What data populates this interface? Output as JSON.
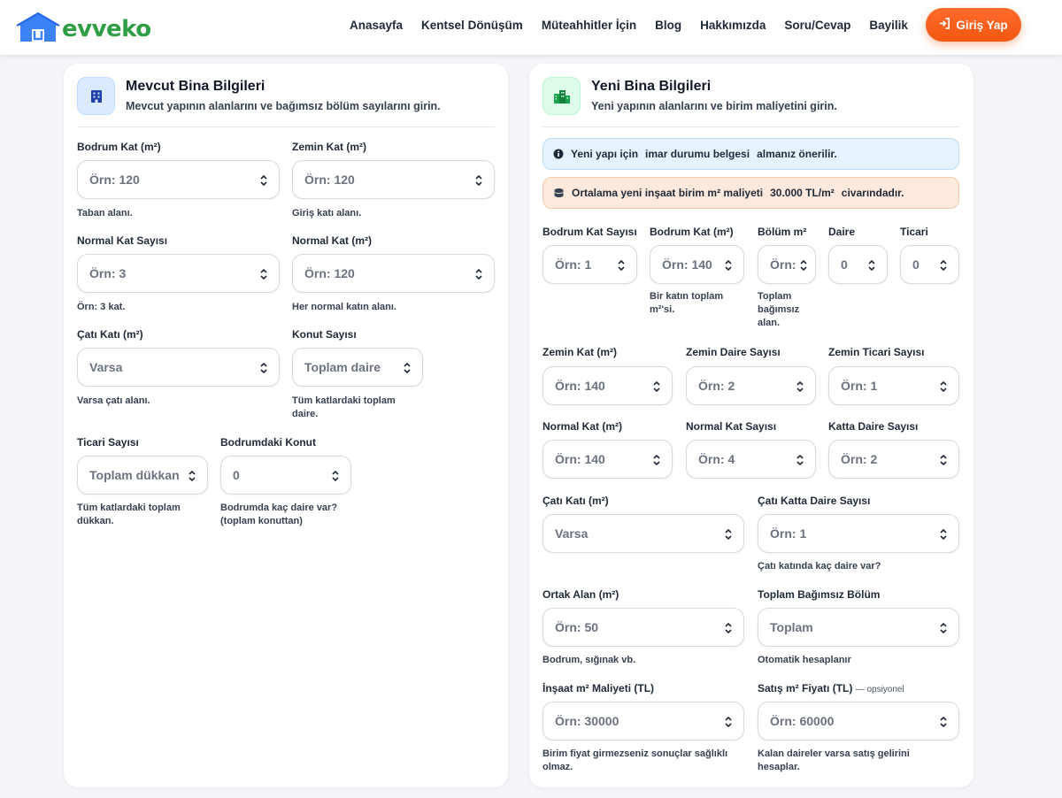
{
  "brand": {
    "logo_text": "evveko",
    "logo_color": "#2f9e44",
    "logo_icon": "house-icon"
  },
  "nav": {
    "links": [
      "Anasayfa",
      "Kentsel Dönüşüm",
      "Müteahhitler İçin",
      "Blog",
      "Hakkımızda",
      "Soru/Cevap",
      "Bayilik"
    ],
    "login_label": "Giriş Yap",
    "login_color": "#f25710"
  },
  "existing": {
    "title": "Mevcut Bina Bilgileri",
    "subtitle": "Mevcut yapının alanlarını ve bağımsız bölüm sayılarını girin.",
    "fields": [
      {
        "label": "Bodrum Kat (m²)",
        "placeholder": "Örn: 120",
        "help": "Taban alanı."
      },
      {
        "label": "Zemin Kat (m²)",
        "placeholder": "Örn: 120",
        "help": "Giriş katı alanı."
      },
      {
        "label": "Normal Kat Sayısı",
        "placeholder": "Örn: 3",
        "help": "Örn: 3 kat."
      },
      {
        "label": "Normal Kat (m²)",
        "placeholder": "Örn: 120",
        "help": "Her normal katın alanı."
      },
      {
        "label": "Çatı Katı (m²)",
        "placeholder": "Varsa",
        "help": "Varsa çatı alanı."
      },
      {
        "label": "Konut Sayısı",
        "placeholder": "Toplam daire",
        "help_1": "Tüm katlardaki toplam",
        "help_2": "daire."
      },
      {
        "label": "Ticari Sayısı",
        "placeholder": "Toplam dükkan",
        "help_1": "Tüm katlardaki toplam",
        "help_2": "dükkan."
      },
      {
        "label": "Bodrumdaki Konut",
        "value": "0",
        "help_1": "Bodrumda kaç daire var?",
        "help_2": "(toplam konuttan)"
      }
    ]
  },
  "new_building": {
    "title": "Yeni Bina Bilgileri",
    "subtitle": "Yeni yapının alanlarını ve birim maliyetini girin.",
    "info_alert": {
      "text_1": "Yeni yapı için",
      "text_2": "imar durumu belgesi",
      "text_3": "almanız önerilir."
    },
    "cost_alert": {
      "text_1": "Ortalama yeni inşaat birim m² maliyeti",
      "text_2": "30.000 TL/m²",
      "text_3": "civarındadır."
    },
    "row1": [
      {
        "label": "Bodrum Kat Sayısı",
        "placeholder": "Örn: 1"
      },
      {
        "label": "Bodrum Kat (m²)",
        "placeholder": "Örn: 140",
        "help_1": "Bir katın toplam",
        "help_2": "m²'si."
      },
      {
        "label": "Bölüm m²",
        "placeholder": "Örn:",
        "help_1": "Toplam",
        "help_2": "bağımsız",
        "help_3": "alan."
      },
      {
        "label": "Daire",
        "value": "0"
      },
      {
        "label": "Ticari",
        "value": "0"
      }
    ],
    "row2": [
      {
        "label": "Zemin Kat (m²)",
        "placeholder": "Örn: 140"
      },
      {
        "label": "Zemin Daire Sayısı",
        "placeholder": "Örn: 2"
      },
      {
        "label": "Zemin Ticari Sayısı",
        "placeholder": "Örn: 1"
      }
    ],
    "row3": [
      {
        "label": "Normal Kat (m²)",
        "placeholder": "Örn: 140"
      },
      {
        "label": "Normal Kat Sayısı",
        "placeholder": "Örn: 4"
      },
      {
        "label": "Katta Daire Sayısı",
        "placeholder": "Örn: 2"
      }
    ],
    "row4": [
      {
        "label": "Çatı Katı (m²)",
        "placeholder": "Varsa"
      },
      {
        "label": "Çatı Katta Daire Sayısı",
        "placeholder": "Örn: 1",
        "help": "Çatı katında kaç daire var?"
      }
    ],
    "row5": [
      {
        "label": "Ortak Alan (m²)",
        "placeholder": "Örn: 50",
        "help": "Bodrum, sığınak vb."
      },
      {
        "label": "Toplam Bağımsız Bölüm",
        "placeholder": "Toplam",
        "help": "Otomatik hesaplanır"
      }
    ],
    "row6": [
      {
        "label": "İnşaat m² Maliyeti (TL)",
        "placeholder": "Örn: 30000",
        "help_1": "Birim fiyat girmezseniz sonuçlar sağlıklı",
        "help_2": "olmaz."
      },
      {
        "label": "Satış m² Fiyatı (TL)",
        "optional": "— opsiyonel",
        "placeholder": "Örn: 60000",
        "help_1": "Kalan daireler varsa satış gelirini",
        "help_2": "hesaplar."
      }
    ]
  }
}
